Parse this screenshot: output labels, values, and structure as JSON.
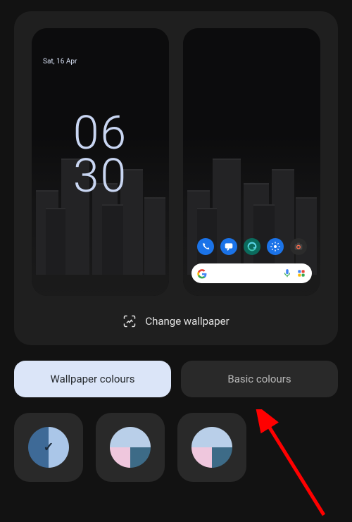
{
  "preview": {
    "lock": {
      "date": "Sat, 16 Apr",
      "clock_top": "06",
      "clock_bottom": "30"
    },
    "home": {
      "dock": [
        {
          "name": "phone-icon",
          "bg": "#1b73e8",
          "glyph": "phone"
        },
        {
          "name": "messages-icon",
          "bg": "#1b73e8",
          "glyph": "chat"
        },
        {
          "name": "edge-icon",
          "bg": "#0b6b5d",
          "glyph": "edge"
        },
        {
          "name": "settings-icon",
          "bg": "#1b73e8",
          "glyph": "gear"
        },
        {
          "name": "camera-icon",
          "bg": "#2b2b2b",
          "glyph": "camera"
        }
      ]
    }
  },
  "change_wallpaper_label": "Change wallpaper",
  "tabs": {
    "wallpaper": "Wallpaper colours",
    "basic": "Basic colours",
    "active": "wallpaper"
  },
  "swatches": [
    {
      "selected": true,
      "colors": {
        "tl": "#3e6a97",
        "tr": "#aac6e8",
        "bl": "#3e6a97",
        "br": "#aac6e8"
      }
    },
    {
      "selected": false,
      "colors": {
        "tl": "#b9cfe9",
        "tr": "#b9cfe9",
        "bl": "#efc7dd",
        "br": "#3d6b87"
      }
    },
    {
      "selected": false,
      "colors": {
        "tl": "#b9cfe9",
        "tr": "#b9cfe9",
        "bl": "#efc7dd",
        "br": "#3d6b87"
      }
    }
  ]
}
